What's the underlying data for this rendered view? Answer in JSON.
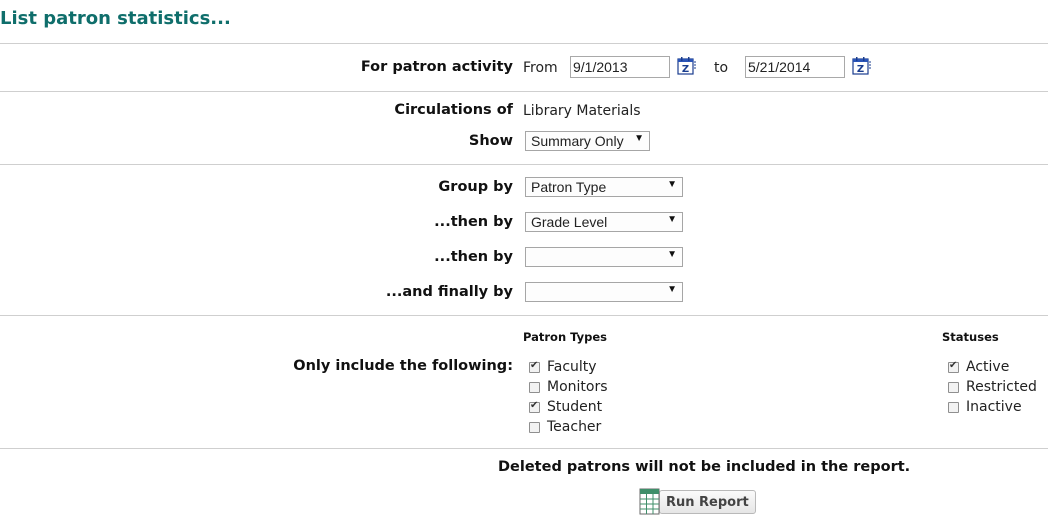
{
  "page": {
    "title": "List patron statistics..."
  },
  "activity": {
    "label": "For patron activity",
    "from_label": "From",
    "from_value": "9/1/2013",
    "to_label": "to",
    "to_value": "5/21/2014",
    "calendar_icon": "calendar-icon"
  },
  "circulations": {
    "label": "Circulations of",
    "value": "Library Materials"
  },
  "show": {
    "label": "Show",
    "selected": "Summary Only"
  },
  "grouping": {
    "group_by_label": "Group by",
    "group_by_value": "Patron Type",
    "then_by_1_label": "...then by",
    "then_by_1_value": "Grade Level",
    "then_by_2_label": "...then by",
    "then_by_2_value": "",
    "finally_by_label": "...and finally by",
    "finally_by_value": ""
  },
  "include": {
    "label": "Only include the following:",
    "patron_types_heading": "Patron Types",
    "patron_types": [
      {
        "label": "Faculty",
        "checked": true
      },
      {
        "label": "Monitors",
        "checked": false
      },
      {
        "label": "Student",
        "checked": true
      },
      {
        "label": "Teacher",
        "checked": false
      }
    ],
    "statuses_heading": "Statuses",
    "statuses": [
      {
        "label": "Active",
        "checked": true
      },
      {
        "label": "Restricted",
        "checked": false
      },
      {
        "label": "Inactive",
        "checked": false
      }
    ]
  },
  "notice": "Deleted patrons will not be included in the report.",
  "run_report": {
    "label": "Run Report",
    "icon": "report-table-icon"
  }
}
